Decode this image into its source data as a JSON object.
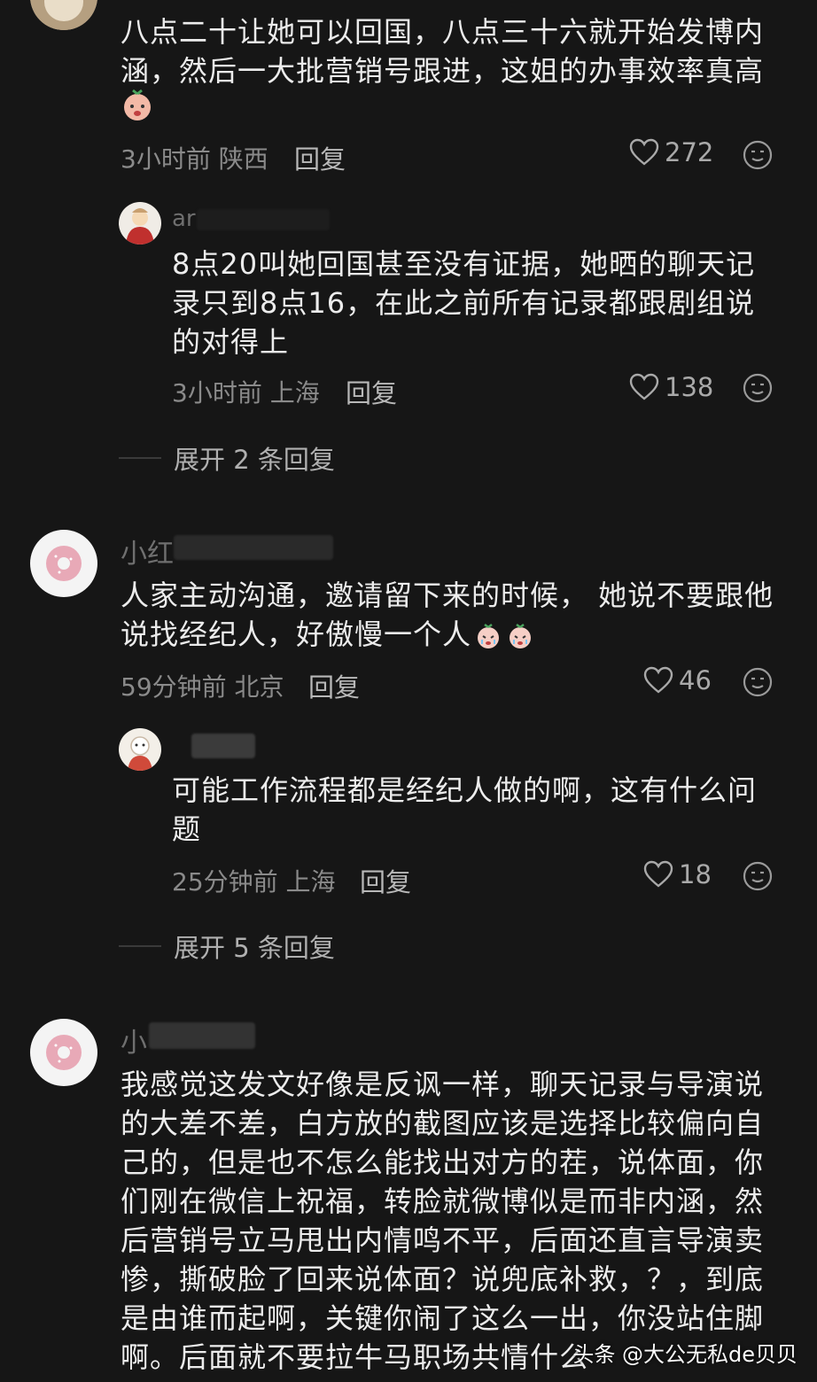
{
  "comments": [
    {
      "text": "八点二十让她可以回国，八点三十六就开始发博内涵，然后一大批营销号跟进，这姐的办事效率真高",
      "time": "3小时前 陕西",
      "reply_label": "回复",
      "likes": "272",
      "reply": {
        "author": "ar",
        "text": "8点20叫她回国甚至没有证据，她晒的聊天记录只到8点16，在此之前所有记录都跟剧组说的对得上",
        "time": "3小时前 上海",
        "reply_label": "回复",
        "likes": "138"
      },
      "expand_label": "展开 2 条回复"
    },
    {
      "author": "小红",
      "text": "人家主动沟通，邀请留下来的时候， 她说不要跟他说找经纪人，好傲慢一个人",
      "time": "59分钟前 北京",
      "reply_label": "回复",
      "likes": "46",
      "reply": {
        "text": "可能工作流程都是经纪人做的啊，这有什么问题",
        "time": "25分钟前 上海",
        "reply_label": "回复",
        "likes": "18"
      },
      "expand_label": "展开 5 条回复"
    },
    {
      "author": "小",
      "text": "我感觉这发文好像是反讽一样，聊天记录与导演说的大差不差，白方放的截图应该是选择比较偏向自己的，但是也不怎么能找出对方的茬，说体面，你们刚在微信上祝福，转脸就微博似是而非内涵，然后营销号立马甩出内情鸣不平，后面还直言导演卖惨，撕破脸了回来说体面？说兜底补救，？，到底是由谁而起啊，关键你闹了这么一出，你没站住脚啊。后面就不要拉牛马职场共情什么"
    }
  ],
  "watermark": "头条 @大公无私de贝贝",
  "icons": {
    "like": "heart-outline-icon",
    "emoji": "emoji-face-icon"
  },
  "colors": {
    "background": "#161616",
    "text": "#ececec",
    "meta": "#8a8a8a"
  }
}
